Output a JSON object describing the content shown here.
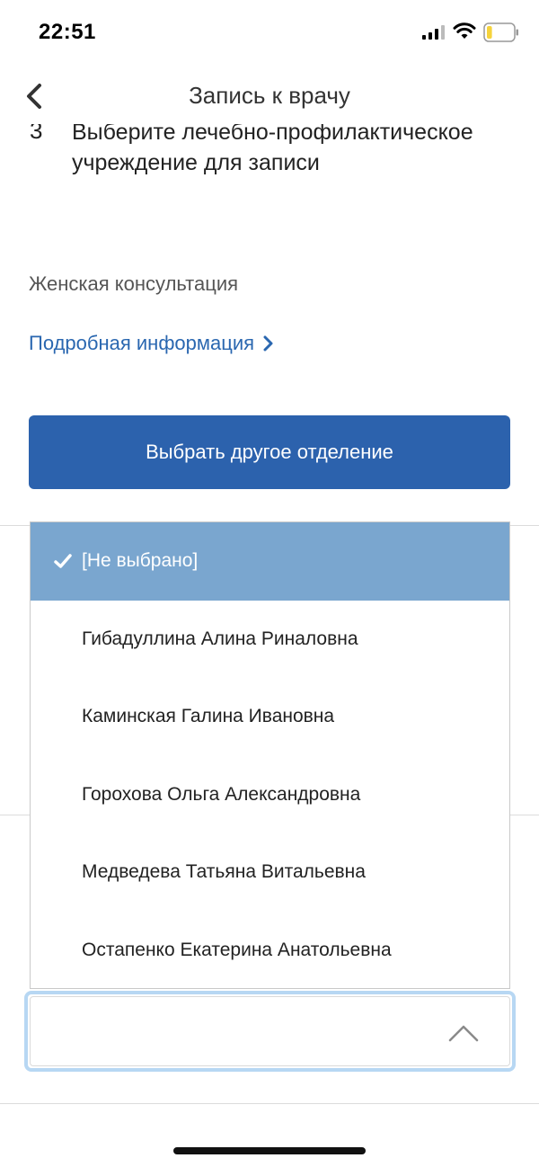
{
  "status_bar": {
    "time": "22:51",
    "icons": [
      "signal-icon",
      "wifi-icon",
      "battery-icon"
    ]
  },
  "nav": {
    "back_icon": "chevron-left-icon",
    "title": "Запись к врачу"
  },
  "step": {
    "number": "3",
    "title": "Выберите лечебно-профилактическое учреждение для записи"
  },
  "department": {
    "name": "Женская консультация",
    "details_link": "Подробная информация"
  },
  "actions": {
    "choose_other_department": "Выбрать другое отделение"
  },
  "dropdown": {
    "options": [
      {
        "label": "[Не выбрано]",
        "selected": true
      },
      {
        "label": "Гибадуллина Алина Риналовна",
        "selected": false
      },
      {
        "label": "Каминская Галина Ивановна",
        "selected": false
      },
      {
        "label": "Горохова Ольга Александровна",
        "selected": false
      },
      {
        "label": "Медведева Татьяна Витальевна",
        "selected": false
      },
      {
        "label": "Остапенко Екатерина Анатольевна",
        "selected": false
      }
    ]
  },
  "select": {
    "value": "",
    "icon": "chevron-up-icon"
  },
  "colors": {
    "primary": "#2c62ad",
    "link": "#2a67b0",
    "selected_option": "#7aa6cf",
    "focus_ring": "#b7d7f3",
    "battery_level": "#f5d33c"
  },
  "battery_level_percent": 20
}
